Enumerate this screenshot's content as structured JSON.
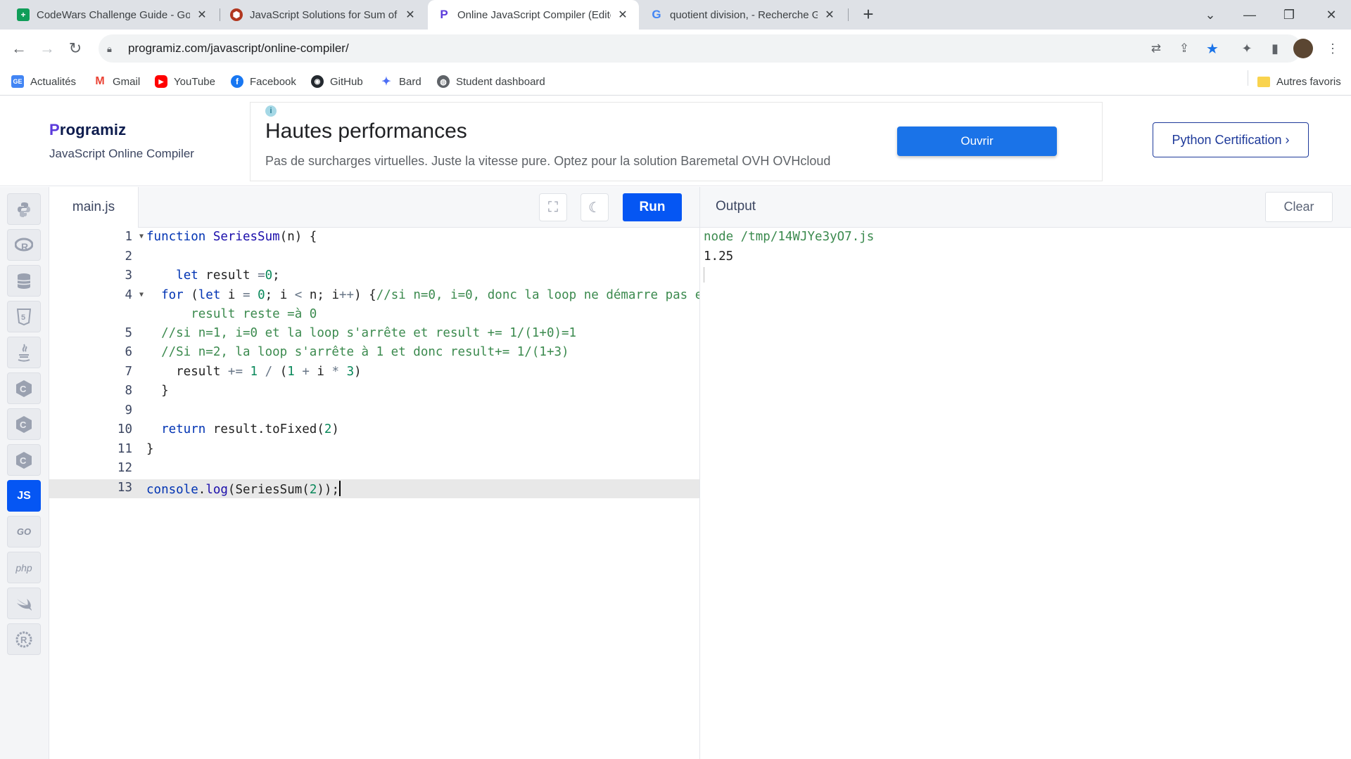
{
  "browser": {
    "tabs": [
      {
        "title": "CodeWars Challenge Guide - Go",
        "favicon": "sheets-icon",
        "color": "#0f9d58"
      },
      {
        "title": "JavaScript Solutions for Sum of th",
        "favicon": "codewars-icon",
        "color": "#b1361e"
      },
      {
        "title": "Online JavaScript Compiler (Edito",
        "favicon": "programiz-icon",
        "color": "#5b3bdb",
        "active": true
      },
      {
        "title": "quotient division, - Recherche Go",
        "favicon": "google-icon",
        "color": "#4285f4"
      }
    ],
    "url": "programiz.com/javascript/online-compiler/",
    "bookmarks": [
      {
        "label": "Actualités",
        "icon": "google-news-icon"
      },
      {
        "label": "Gmail",
        "icon": "gmail-icon"
      },
      {
        "label": "YouTube",
        "icon": "youtube-icon"
      },
      {
        "label": "Facebook",
        "icon": "facebook-icon"
      },
      {
        "label": "GitHub",
        "icon": "github-icon"
      },
      {
        "label": "Bard",
        "icon": "bard-icon"
      },
      {
        "label": "Student dashboard",
        "icon": "globe-icon"
      }
    ],
    "other_bookmarks": "Autres favoris"
  },
  "site": {
    "logo_prefix": "P",
    "logo_rest": "rogramiz",
    "subtitle": "JavaScript Online Compiler",
    "ad": {
      "headline": "Hautes performances",
      "description": "Pas de surcharges virtuelles. Juste la vitesse pure. Optez pour la solution Baremetal OVH OVHcloud",
      "button": "Ouvrir"
    },
    "certification_button": "Python Certification ›"
  },
  "languages": [
    {
      "name": "python-icon",
      "label": ""
    },
    {
      "name": "r-icon",
      "label": ""
    },
    {
      "name": "sql-icon",
      "label": ""
    },
    {
      "name": "html-icon",
      "label": ""
    },
    {
      "name": "java-icon",
      "label": ""
    },
    {
      "name": "c-icon",
      "label": ""
    },
    {
      "name": "cpp-icon",
      "label": ""
    },
    {
      "name": "csharp-icon",
      "label": ""
    },
    {
      "name": "js-icon",
      "label": "JS",
      "active": true
    },
    {
      "name": "go-icon",
      "label": "GO"
    },
    {
      "name": "php-icon",
      "label": "php"
    },
    {
      "name": "swift-icon",
      "label": ""
    },
    {
      "name": "rust-icon",
      "label": ""
    }
  ],
  "editor": {
    "filename": "main.js",
    "run_label": "Run",
    "line_numbers": [
      "1",
      "2",
      "3",
      "4",
      "5",
      "6",
      "7",
      "8",
      "9",
      "10",
      "11",
      "12",
      "13"
    ]
  },
  "output": {
    "title": "Output",
    "clear_label": "Clear",
    "lines": [
      "node /tmp/14WJYe3yO7.js",
      "1.25"
    ]
  },
  "colors": {
    "accent": "#0556f3",
    "ad_button": "#1a73e8",
    "comment": "#3b8a4e",
    "number": "#09885a",
    "keyword": "#0033b3"
  }
}
